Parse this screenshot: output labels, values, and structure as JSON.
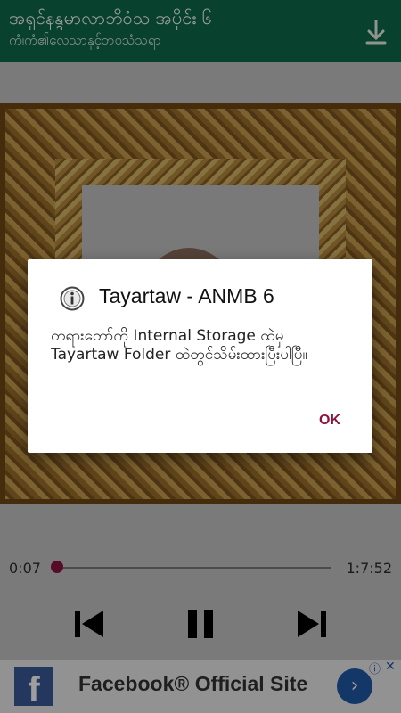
{
  "app_bar": {
    "title": "အရှင်နန္ဒမာလာဘိဝံသ အပိုင်း ၆",
    "subtitle": "ကံ၊ကံ၏လေသာနှင့်ဘဝသံသရာ",
    "download_icon": "download-icon"
  },
  "player": {
    "elapsed": "0:07",
    "duration": "1:7:52",
    "progress_fraction": 0.004,
    "controls": [
      "skip-previous-icon",
      "pause-icon",
      "skip-next-icon"
    ]
  },
  "dialog": {
    "icon": "info-icon",
    "title": "Tayartaw - ANMB 6",
    "message": "တရားတော်ကို Internal Storage ထဲမှ Tayartaw Folder ထဲတွင်သိမ်းထားပြီးပါပြီ။",
    "ok_label": "OK"
  },
  "ad": {
    "logo": "f",
    "text": "Facebook® Official Site",
    "info_icon": "ⓘ",
    "close_icon": "✕",
    "go_icon": "›"
  },
  "colors": {
    "app_bar": "#0e6b4b",
    "accent": "#8b1440",
    "facebook": "#3b5998"
  }
}
